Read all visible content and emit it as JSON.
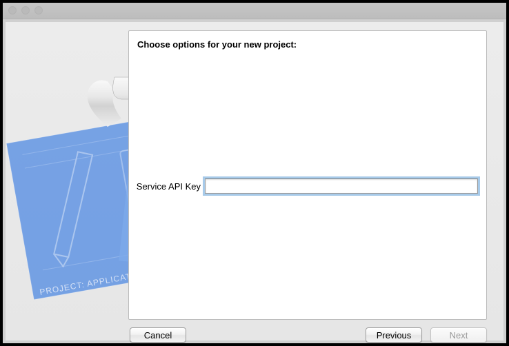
{
  "dialog": {
    "title": "Choose options for your new project:",
    "fields": {
      "api_key": {
        "label": "Service API Key",
        "value": ""
      }
    }
  },
  "buttons": {
    "cancel": "Cancel",
    "previous": "Previous",
    "next": "Next"
  }
}
